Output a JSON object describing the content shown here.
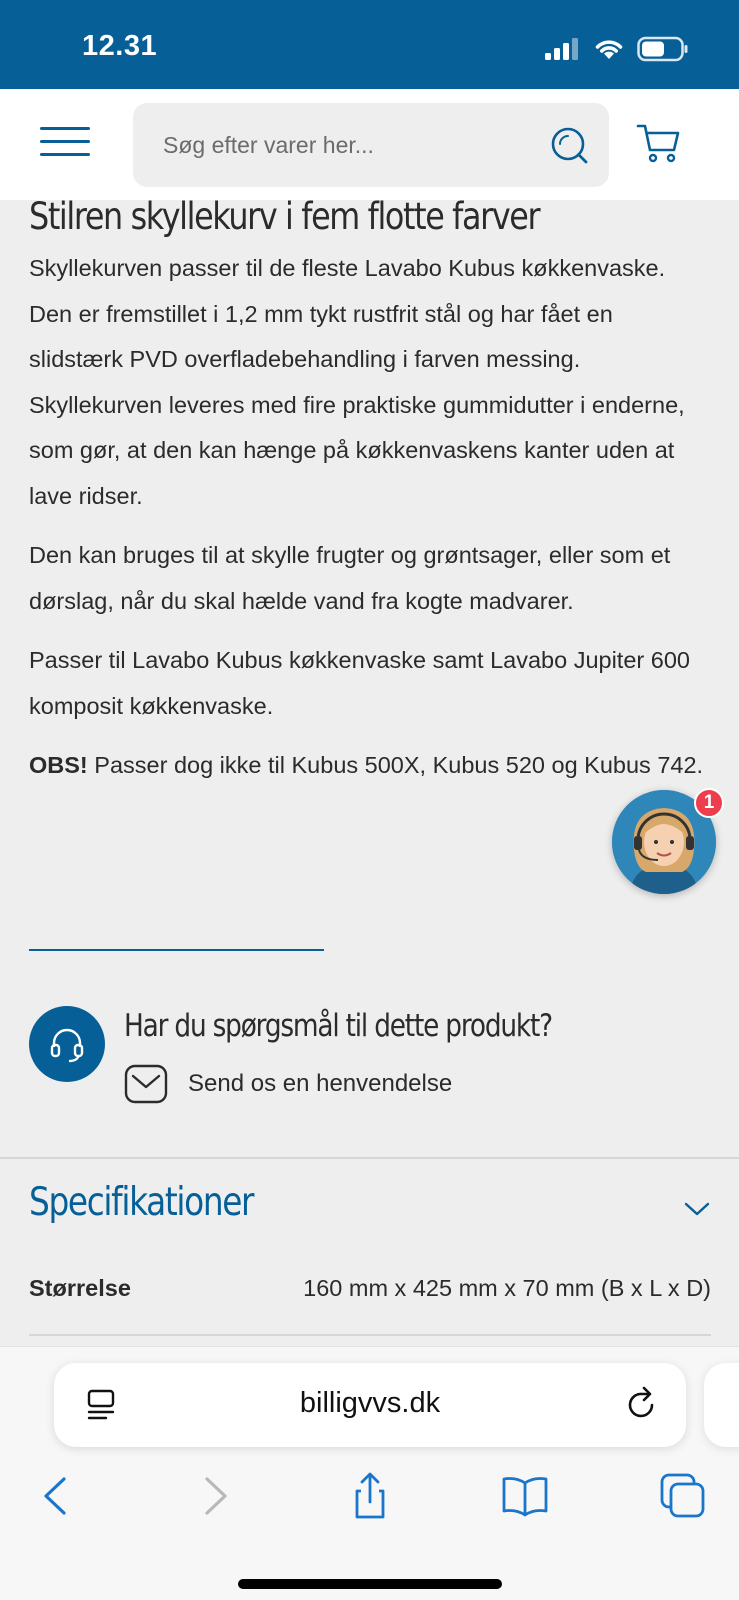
{
  "status_bar": {
    "time": "12.31"
  },
  "header": {
    "search_placeholder": "Søg efter varer her..."
  },
  "product": {
    "title": "Stilren skyllekurv i fem flotte farver",
    "paragraphs": [
      "Skyllekurven passer til de fleste Lavabo Kubus køkkenvaske. Den er fremstillet i 1,2 mm tykt rustfrit stål og har fået en slidstærk PVD overfladebehandling i farven messing. Skyllekurven leveres med fire praktiske gummidutter i enderne, som gør, at den kan hænge på køkkenvaskens kanter uden at lave ridser.",
      "Den kan bruges til at skylle frugter og grøntsager, eller som et dørslag, når du skal hælde vand fra kogte madvarer.",
      "Passer til Lavabo Kubus køkkenvaske samt Lavabo Jupiter 600 komposit køkkenvaske."
    ],
    "note_label": "OBS!",
    "note_text": " Passer dog ikke til Kubus 500X, Kubus 520 og Kubus 742."
  },
  "help": {
    "title": "Har du spørgsmål til dette produkt?",
    "link_label": "Send os en henvendelse"
  },
  "specs": {
    "title": "Specifikationer",
    "rows": [
      {
        "key": "Størrelse",
        "value": "160 mm x 425 mm x 70 mm (B x L x D)"
      }
    ]
  },
  "chat": {
    "badge_count": "1"
  },
  "browser": {
    "url": "billigvvs.dk"
  },
  "colors": {
    "brand": "#075f97",
    "badge": "#ee3e4e",
    "background": "#eeeeee"
  }
}
